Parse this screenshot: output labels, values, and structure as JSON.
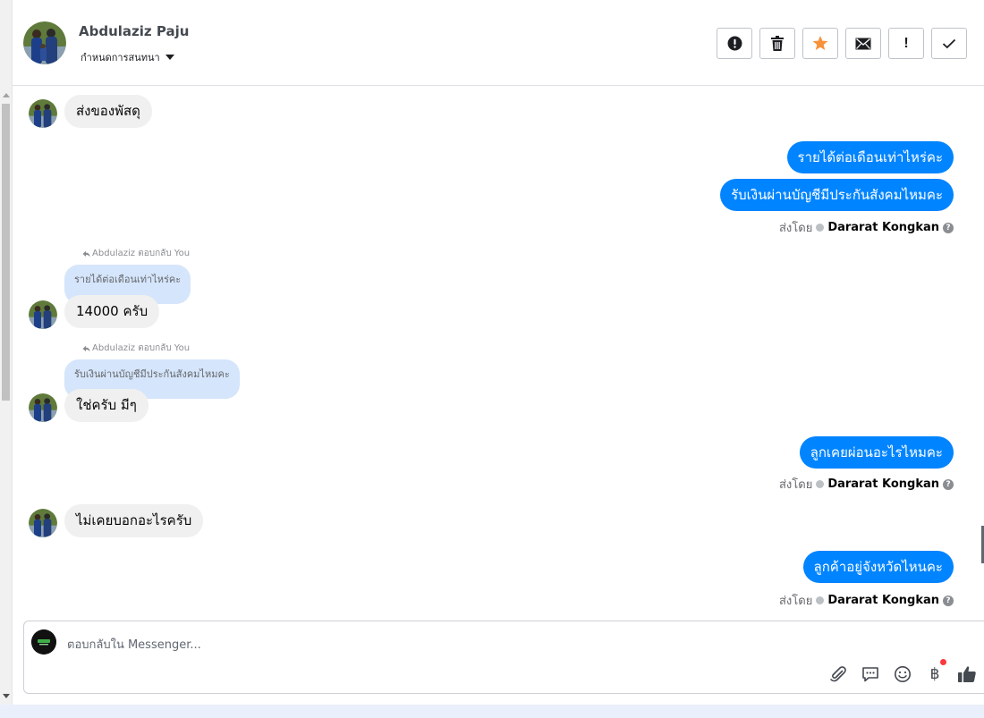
{
  "header": {
    "contact_name": "Abdulaziz Paju",
    "assign_label": "กำหนดการสนทนา",
    "actions": [
      {
        "name": "spam-button",
        "icon": "alert-circle-icon"
      },
      {
        "name": "delete-button",
        "icon": "trash-icon"
      },
      {
        "name": "star-button",
        "icon": "star-icon"
      },
      {
        "name": "mark-unread-button",
        "icon": "envelope-icon"
      },
      {
        "name": "follow-up-button",
        "icon": "exclamation-icon"
      },
      {
        "name": "mark-done-button",
        "icon": "check-icon"
      }
    ],
    "star_color": "#f7923b"
  },
  "messages": {
    "m1_in": "ส่งของพัสดุ",
    "m2_out": "รายได้ต่อเดือนเท่าไหร่คะ",
    "m3_out": "รับเงินผ่านบัญชีมีประกันสังคมไหมคะ",
    "sent_by_1": {
      "prefix": "ส่งโดย",
      "name": "Dararat Kongkan",
      "help": "?"
    },
    "reply_label_1": "Abdulaziz ตอบกลับ You",
    "quote_1": "รายได้ต่อเดือนเท่าไหร่คะ",
    "m4_in": "14000 ครับ",
    "reply_label_2": "Abdulaziz ตอบกลับ You",
    "quote_2": "รับเงินผ่านบัญชีมีประกันสังคมไหมคะ",
    "m5_in": "ใช่ครับ มีๆ",
    "m6_out": "ลูกเคยผ่อนอะไรไหมคะ",
    "sent_by_2": {
      "prefix": "ส่งโดย",
      "name": "Dararat Kongkan",
      "help": "?"
    },
    "m7_in": "ไม่เคยบอกอะไรครับ",
    "m8_out": "ลูกค้าอยู่จังหวัดไหนคะ",
    "sent_by_3": {
      "prefix": "ส่งโดย",
      "name": "Dararat Kongkan",
      "help": "?"
    }
  },
  "composer": {
    "placeholder": "ตอบกลับใน Messenger...",
    "tools": [
      "paperclip-icon",
      "saved-reply-icon",
      "emoji-icon",
      "baht-icon",
      "thumbs-up-icon"
    ],
    "baht_symbol": "฿"
  },
  "colors": {
    "outgoing_bubble": "#0084ff",
    "incoming_bubble": "#f0f0f0",
    "quoted_bubble": "#d5e5fb"
  }
}
